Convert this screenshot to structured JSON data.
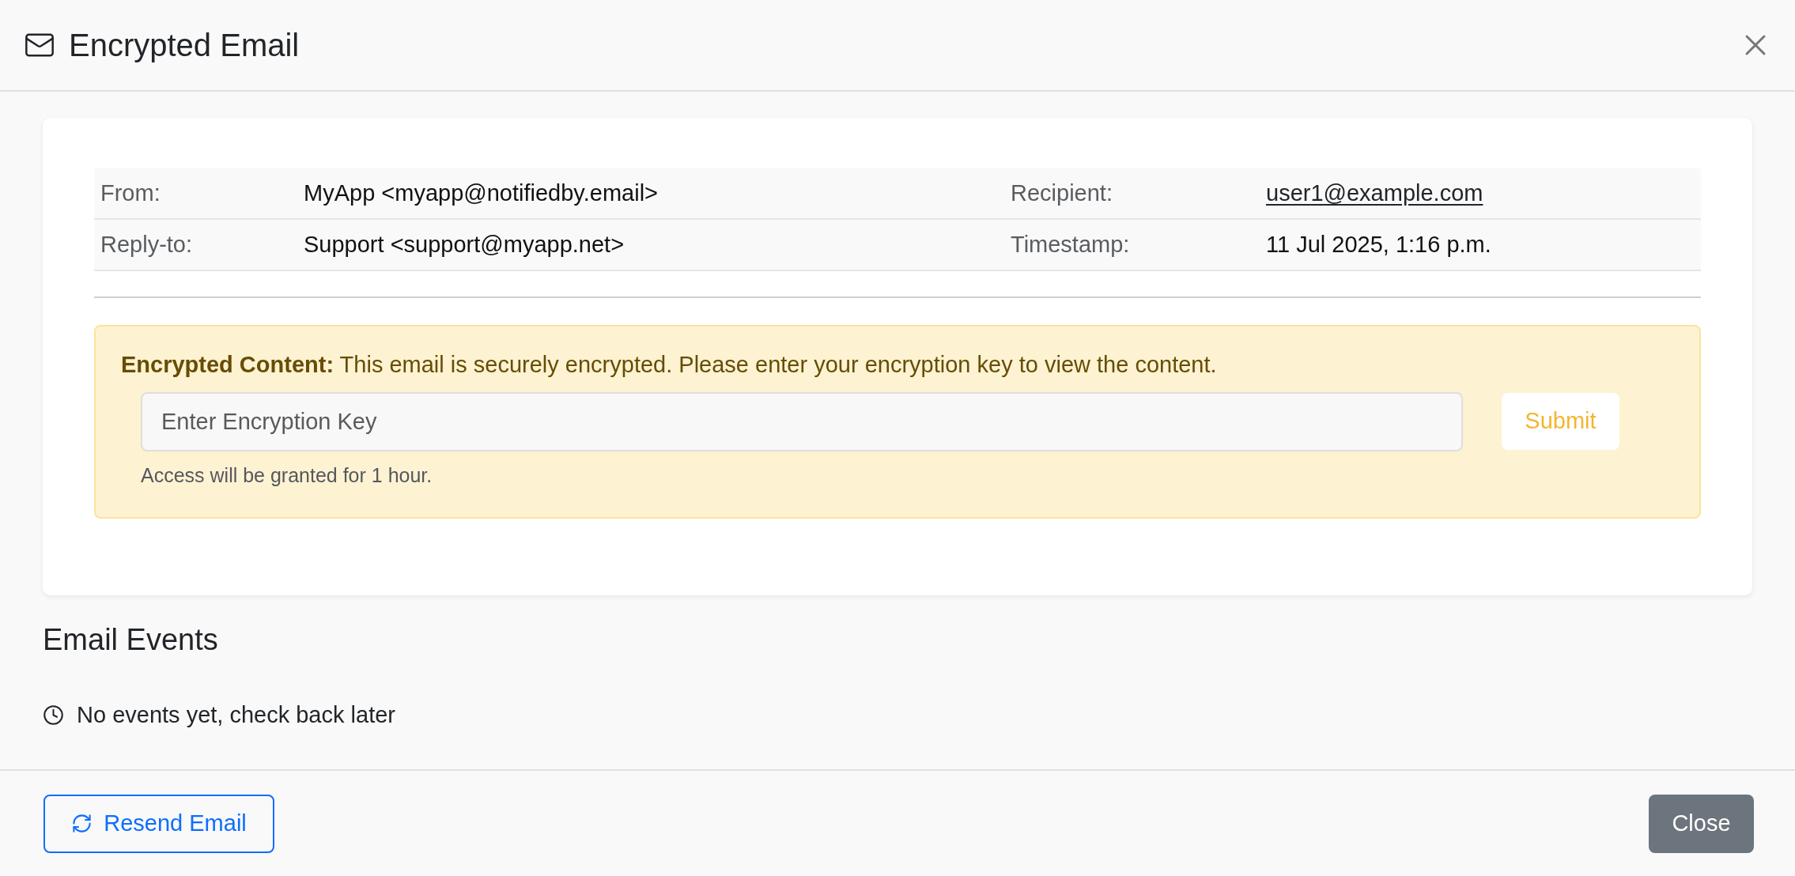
{
  "window": {
    "title": "Encrypted Email"
  },
  "details": {
    "rows": [
      {
        "fields": [
          {
            "label": "From:",
            "value": "MyApp <myapp@notifiedby.email>",
            "kind": "text"
          },
          {
            "label": "Recipient:",
            "value": "user1@example.com",
            "kind": "link"
          }
        ]
      },
      {
        "fields": [
          {
            "label": "Reply-to:",
            "value": "Support <support@myapp.net>",
            "kind": "text"
          },
          {
            "label": "Timestamp:",
            "value": "11 Jul 2025, 1:16 p.m.",
            "kind": "text"
          }
        ]
      }
    ]
  },
  "encrypted_notice": {
    "message": "**Encrypted Content:** This email is securely encrypted. Please enter your encryption key to view the content.",
    "key_field": {
      "placeholder": "Enter Encryption Key"
    },
    "submit_button": "Submit",
    "help_text": "Access will be granted for 1 hour."
  },
  "email_events": {
    "title": "Email Events",
    "empty_message": "No events yet, check back later"
  },
  "footer": {
    "resend_button": "Resend Email",
    "close_button": "Close"
  }
}
